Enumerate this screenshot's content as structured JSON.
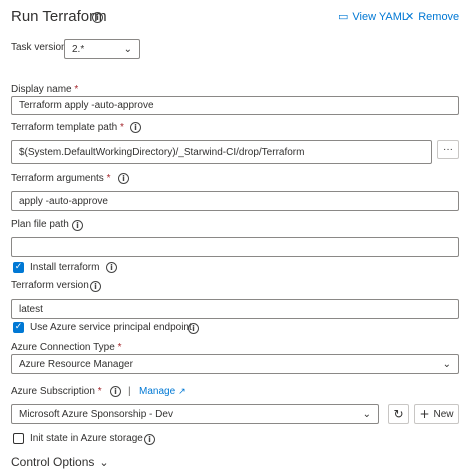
{
  "header": {
    "title": "Run Terraform",
    "view_yaml_label": "View YAML",
    "remove_label": "Remove"
  },
  "task_version": {
    "label": "Task version",
    "value": "2.*"
  },
  "display_name": {
    "label": "Display name",
    "required": "*",
    "value": "Terraform apply -auto-approve"
  },
  "template_path": {
    "label": "Terraform template path",
    "required": "*",
    "value": "$(System.DefaultWorkingDirectory)/_Starwind-CI/drop/Terraform",
    "browse_label": "···"
  },
  "arguments": {
    "label": "Terraform arguments",
    "required": "*",
    "value": "apply -auto-approve"
  },
  "plan_file": {
    "label": "Plan file path",
    "value": ""
  },
  "install_terraform": {
    "label": "Install terraform",
    "checked": true
  },
  "terraform_version": {
    "label": "Terraform version",
    "value": "latest"
  },
  "use_sp": {
    "label": "Use Azure service principal endpoint",
    "checked": true
  },
  "connection_type": {
    "label": "Azure Connection Type",
    "required": "*",
    "value": "Azure Resource Manager"
  },
  "subscription": {
    "label": "Azure Subscription",
    "required": "*",
    "separator": "|",
    "manage_label": "Manage",
    "value": "Microsoft Azure Sponsorship - Dev",
    "new_label": "New"
  },
  "init_state": {
    "label": "Init state in Azure storage",
    "checked": false
  },
  "control_options": {
    "label": "Control Options"
  },
  "colors": {
    "accent": "#0078d4",
    "required": "#a4262c",
    "border": "#8a8886"
  }
}
